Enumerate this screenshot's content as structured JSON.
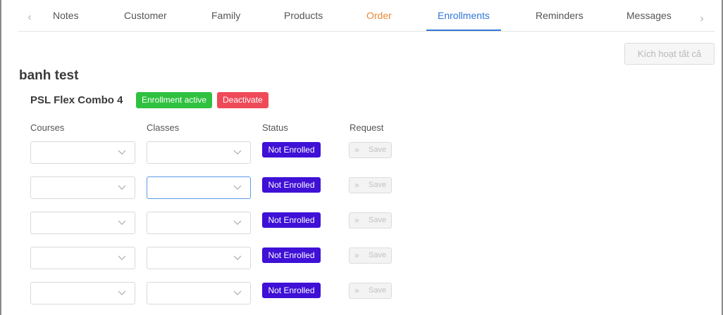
{
  "tabs": {
    "items": [
      "Notes",
      "Customer",
      "Family",
      "Products",
      "Order",
      "Enrollments",
      "Reminders",
      "Messages"
    ],
    "active": "Enrollments",
    "prev_icon": "chevron-left-icon",
    "next_icon": "chevron-right-icon"
  },
  "toolbar": {
    "activate_all_label": "Kích hoạt tất cả"
  },
  "student": {
    "name": "banh test"
  },
  "product": {
    "name": "PSL Flex Combo 4",
    "enrollment_badge": "Enrollment active",
    "deactivate_label": "Deactivate"
  },
  "table": {
    "headers": [
      "Courses",
      "Classes",
      "Status",
      "Request"
    ],
    "rows": [
      {
        "course": "",
        "class": "",
        "status": "Not Enrolled",
        "request": "Save"
      },
      {
        "course": "",
        "class": "",
        "status": "Not Enrolled",
        "request": "Save"
      },
      {
        "course": "",
        "class": "",
        "status": "Not Enrolled",
        "request": "Save"
      },
      {
        "course": "",
        "class": "",
        "status": "Not Enrolled",
        "request": "Save"
      },
      {
        "course": "",
        "class": "",
        "status": "Not Enrolled",
        "request": "Save"
      }
    ]
  },
  "colors": {
    "accent": "#3277d8",
    "order_tab": "#e98a3a",
    "badge_active": "#2fc13f",
    "badge_deactivate": "#ef4a58",
    "status_not_enrolled": "#3f10d6"
  }
}
